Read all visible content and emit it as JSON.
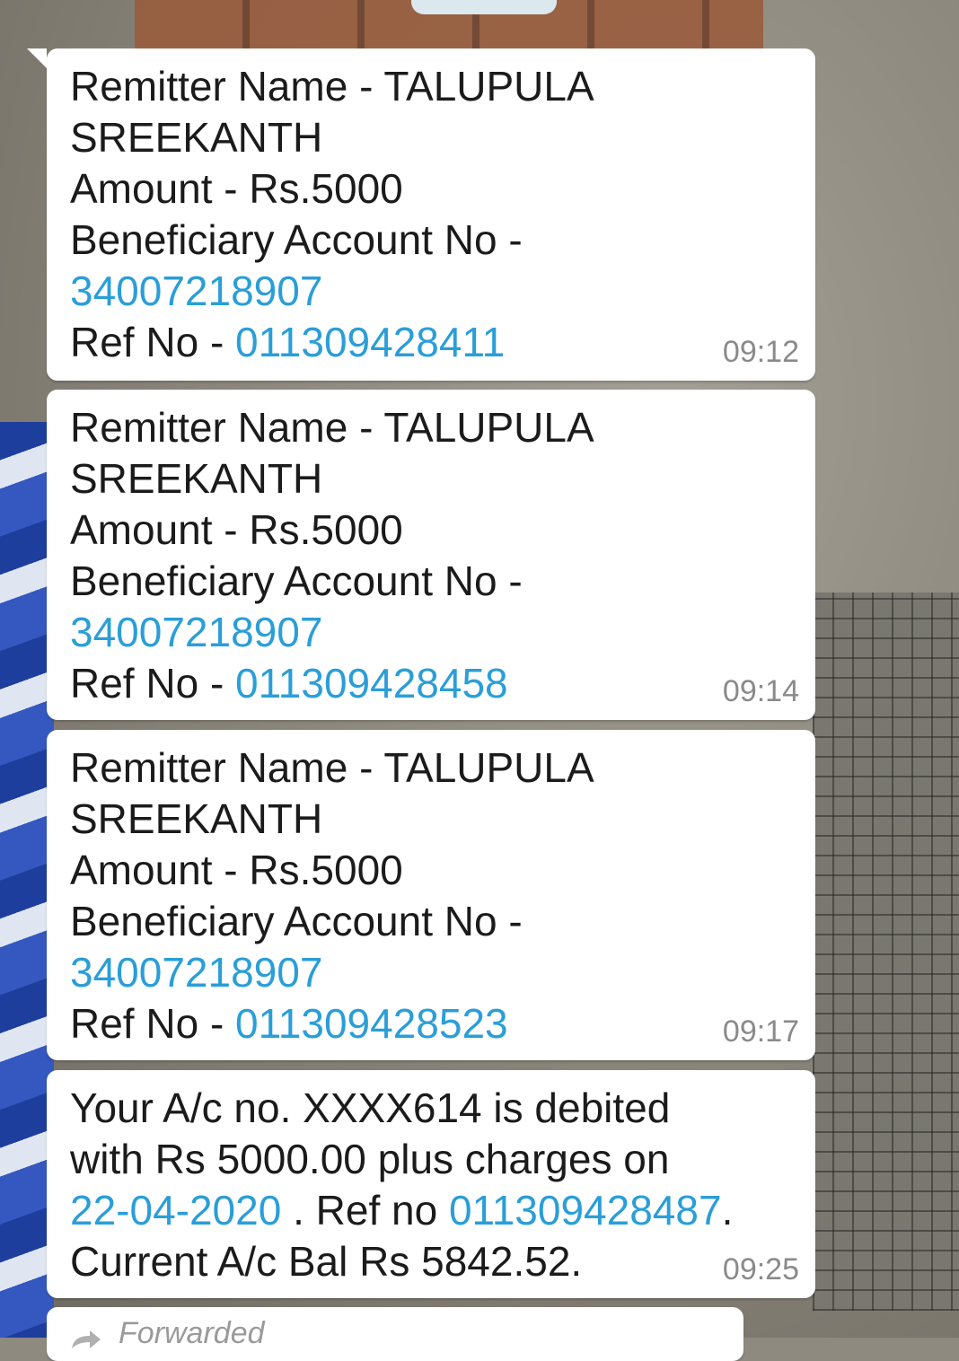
{
  "messages": [
    {
      "remitter_label": "Remitter Name - TALUPULA",
      "remitter_cont": "SREEKANTH",
      "amount": "Amount - Rs.5000",
      "beneficiary_label": "Beneficiary Account No -",
      "beneficiary_no": "34007218907",
      "ref_label": "Ref No - ",
      "ref_no": "011309428411",
      "time": "09:12"
    },
    {
      "remitter_label": "Remitter Name - TALUPULA",
      "remitter_cont": "SREEKANTH",
      "amount": "Amount - Rs.5000",
      "beneficiary_label": "Beneficiary Account No -",
      "beneficiary_no": "34007218907",
      "ref_label": "Ref No - ",
      "ref_no": "011309428458",
      "time": "09:14"
    },
    {
      "remitter_label": "Remitter Name - TALUPULA",
      "remitter_cont": "SREEKANTH",
      "amount": "Amount - Rs.5000",
      "beneficiary_label": "Beneficiary Account No -",
      "beneficiary_no": "34007218907",
      "ref_label": "Ref No - ",
      "ref_no": "011309428523",
      "time": "09:17"
    }
  ],
  "debit_message": {
    "line1": "Your A/c no. XXXX614 is debited",
    "line2": "with Rs 5000.00 plus charges on",
    "date": "22-04-2020",
    "mid": " . Ref no ",
    "ref_no": "011309428487",
    "end": ".",
    "line4": "Current A/c Bal Rs 5842.52.",
    "time": "09:25"
  },
  "forwarded": {
    "label": "Forwarded",
    "icon": "forward-arrow-icon"
  },
  "colors": {
    "link": "#2a9ed8",
    "bubble": "#ffffff",
    "time": "#8a8a8a"
  }
}
